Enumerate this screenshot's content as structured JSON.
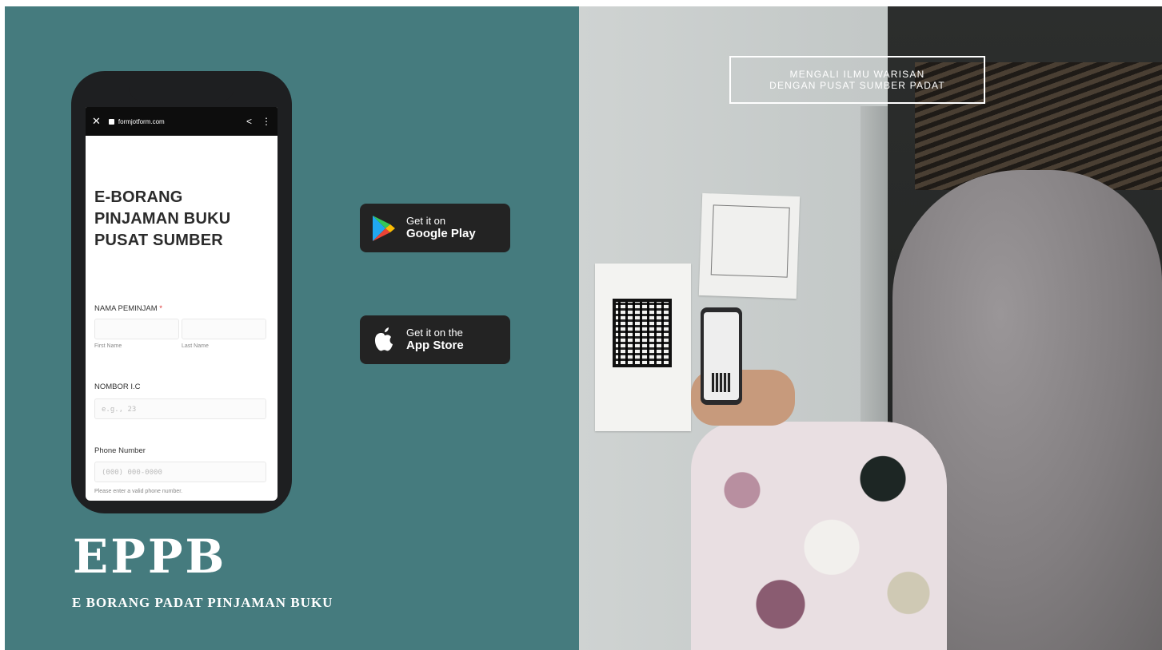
{
  "phone": {
    "url": "formjotform.com",
    "form_title": "E-BORANG PINJAMAN BUKU PUSAT SUMBER",
    "field_name_label": "NAMA PEMINJAM",
    "required_mark": "*",
    "first_name_label": "First Name",
    "last_name_label": "Last Name",
    "field_ic_label": "NOMBOR I.C",
    "ic_placeholder": "e.g., 23",
    "field_phone_label": "Phone Number",
    "phone_placeholder": "(000) 000-0000",
    "phone_hint": "Please enter a valid phone number."
  },
  "google_play": {
    "small": "Get it on",
    "big": "Google Play"
  },
  "app_store": {
    "small": "Get it on the",
    "big": "App Store"
  },
  "brand": {
    "title": "EPPB",
    "subtitle": "E BORANG PADAT PINJAMAN BUKU"
  },
  "tagline": {
    "line1": "MENGALI ILMU WARISAN",
    "line2": "DENGAN PUSAT SUMBER PADAT"
  },
  "colors": {
    "panel": "#457b7e",
    "button": "#232323"
  }
}
